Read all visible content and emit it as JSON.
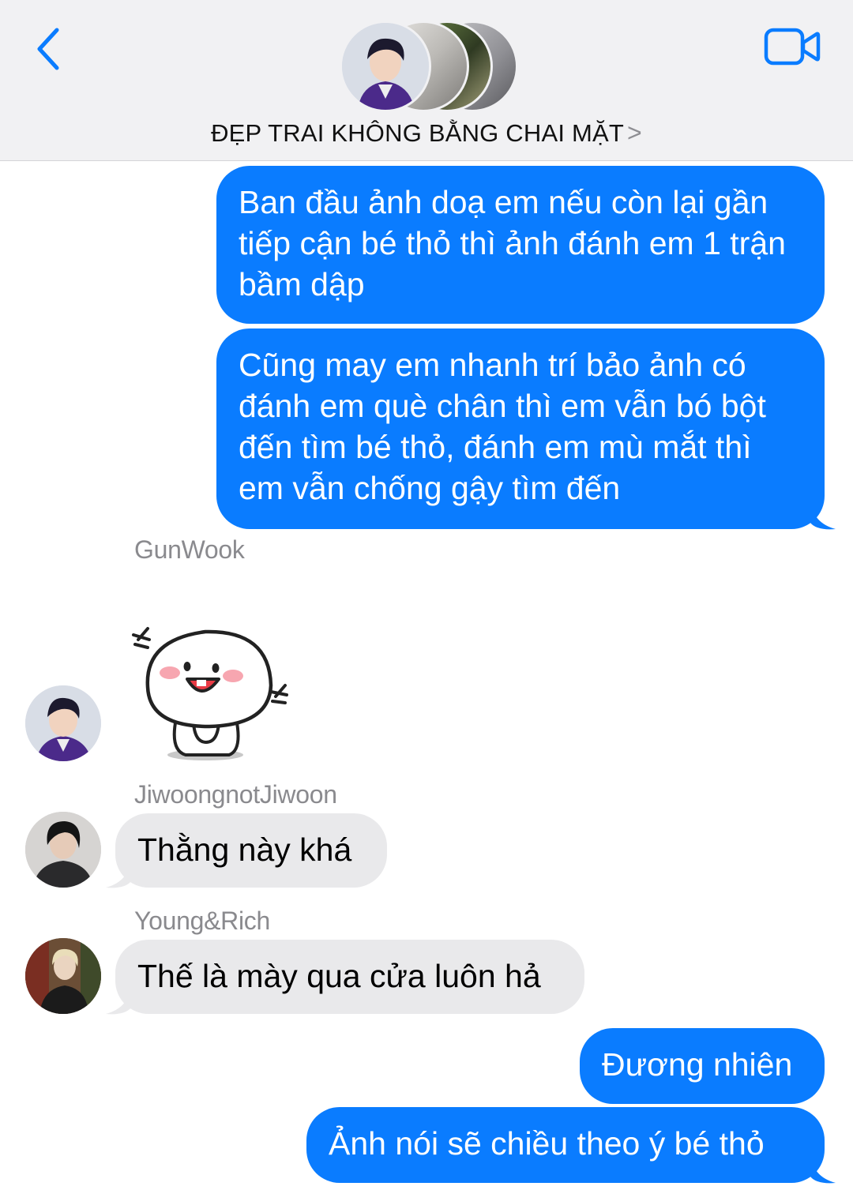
{
  "header": {
    "title": "ĐẸP TRAI KHÔNG BẰNG CHAI MẶT",
    "chevron": ">",
    "back_icon": "chevron-left-icon",
    "video_icon": "video-camera-icon",
    "accent_color": "#0a7cff"
  },
  "messages": [
    {
      "type": "outgoing",
      "text": "Ban đầu ảnh doạ em nếu còn lại gần tiếp cận bé thỏ thì ảnh đánh em 1 trận bầm dập"
    },
    {
      "type": "outgoing",
      "text": "Cũng may em nhanh trí bảo ảnh có đánh em què chân thì em vẫn bó bột đến tìm bé thỏ, đánh em mù mắt thì em vẫn chống gậy tìm đến"
    },
    {
      "type": "incoming-sticker",
      "sender": "GunWook",
      "sticker": "smiling-bean-sticker"
    },
    {
      "type": "incoming",
      "sender": "JiwoongnotJiwoon",
      "text": "Thằng này khá"
    },
    {
      "type": "incoming",
      "sender": "Young&Rich",
      "text": "Thế là mày qua cửa luôn hả"
    },
    {
      "type": "outgoing",
      "text": "Đương nhiên"
    },
    {
      "type": "outgoing",
      "text": "Ảnh nói sẽ chiều theo ý bé thỏ"
    }
  ]
}
